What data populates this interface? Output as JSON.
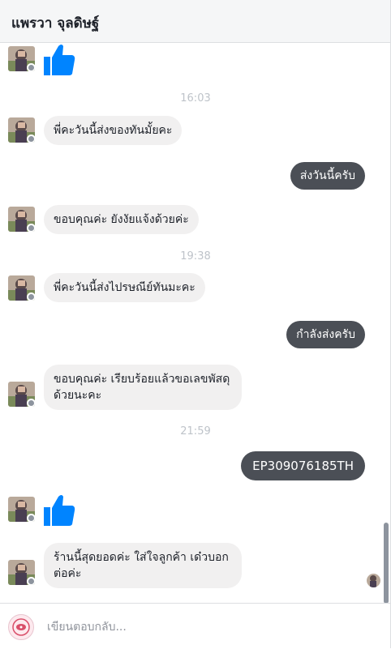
{
  "header": {
    "contact_name": "แพรวา จุลดิษฐ์"
  },
  "messages": {
    "t1": "16:03",
    "m1": "พี่คะวันนี้ส่งของทันมั้ยคะ",
    "m2": "ส่งวันนี้ครับ",
    "m3": "ขอบคุณค่ะ ยังงัยแจ้งด้วยค่ะ",
    "t2": "19:38",
    "m4": "พี่คะวันนี้ส่งไปรษณีย์ทันมะคะ",
    "m5": "กำลังส่งครับ",
    "m6": "ขอบคุณค่ะ เรียบร้อยแล้วขอเลขพัสดุด้วยนะคะ",
    "t3": "21:59",
    "m7": "EP309076185TH",
    "m8": "ร้านนี้สุดยอดค่ะ ใส่ใจลูกค้า เด๋วบอกต่อค่ะ"
  },
  "composer": {
    "placeholder": "เขียนตอบกลับ..."
  },
  "colors": {
    "like_blue": "#0084ff",
    "outgoing_bubble": "#4b4f56",
    "incoming_bubble": "#f1f0f0"
  },
  "icons": {
    "like": "thumbs-up-icon",
    "avatar": "contact-avatar",
    "messenger_badge": "messenger-dot-icon"
  }
}
